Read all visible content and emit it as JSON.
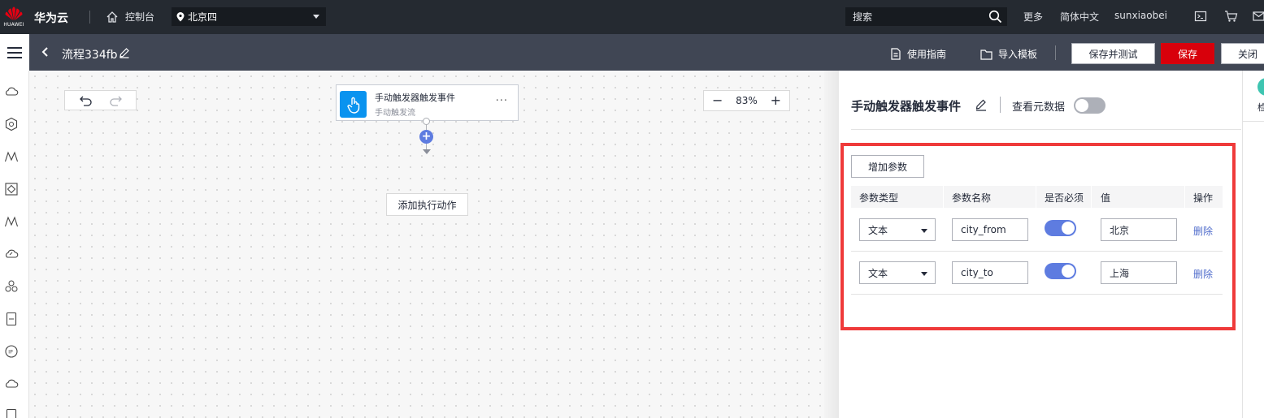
{
  "topbar": {
    "logo_text": "HUAWEI",
    "brand": "华为云",
    "console": "控制台",
    "region": "北京四",
    "search_placeholder": "搜索",
    "more": "更多",
    "language": "简体中文",
    "username": "sunxiaobei"
  },
  "subbar": {
    "flow_title": "流程334fb",
    "guide": "使用指南",
    "import_template": "导入模板",
    "save_and_test": "保存并测试",
    "save": "保存",
    "close": "关闭"
  },
  "canvas": {
    "zoom": "83%",
    "trigger_node": {
      "title": "手动触发器触发事件",
      "subtitle": "手动触发流",
      "more": "···"
    },
    "add_action": "添加执行动作"
  },
  "panel": {
    "title": "手动触发器触发事件",
    "view_metadata": "查看元数据",
    "add_param": "增加参数",
    "columns": [
      "参数类型",
      "参数名称",
      "是否必须",
      "值",
      "操作"
    ],
    "rows": [
      {
        "type": "文本",
        "name": "city_from",
        "required": true,
        "value": "北京",
        "action": "删除"
      },
      {
        "type": "文本",
        "name": "city_to",
        "required": true,
        "value": "上海",
        "action": "删除"
      }
    ]
  },
  "far_right": {
    "label": "检"
  },
  "colors": {
    "accent": "#5e7ce0",
    "save": "#d8000b",
    "highlight": "#ef3a3a",
    "node_icon": "#0a93ef"
  },
  "icons": {
    "logo": "huawei-logo",
    "home": "home-icon",
    "location": "location-pin-icon",
    "search": "search-icon",
    "terminal": "terminal-icon",
    "cart": "cart-icon",
    "mail": "mail-icon"
  }
}
